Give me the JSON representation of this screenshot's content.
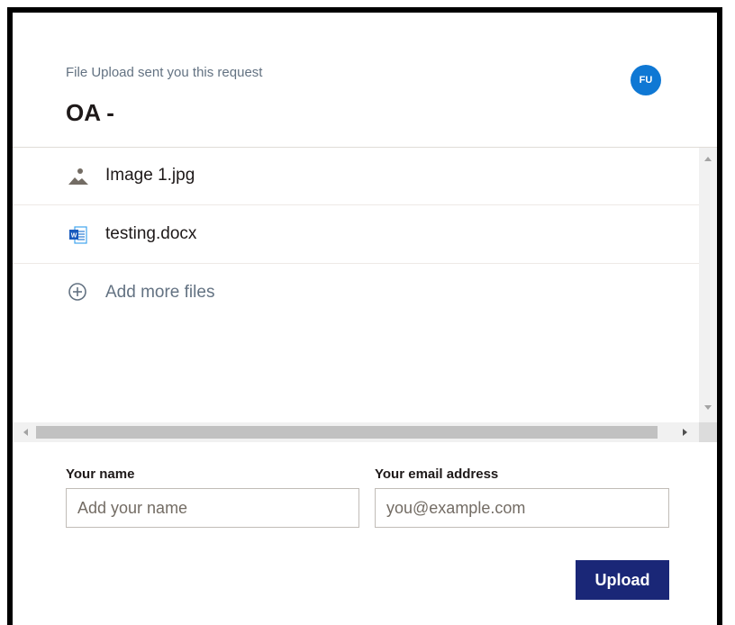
{
  "header": {
    "requester_text": "File Upload sent you this request",
    "title": "OA -",
    "avatar_initials": "FU",
    "avatar_color": "#0f78d4"
  },
  "files": [
    {
      "name": "Image 1.jpg",
      "icon": "image-file-icon"
    },
    {
      "name": "testing.docx",
      "icon": "word-document-icon"
    }
  ],
  "add_more": {
    "label": "Add more files",
    "icon": "add-circle-icon"
  },
  "form": {
    "name_label": "Your name",
    "name_placeholder": "Add your name",
    "name_value": "",
    "email_label": "Your email address",
    "email_placeholder": "you@example.com",
    "email_value": "",
    "upload_label": "Upload",
    "upload_color": "#1a2777"
  }
}
